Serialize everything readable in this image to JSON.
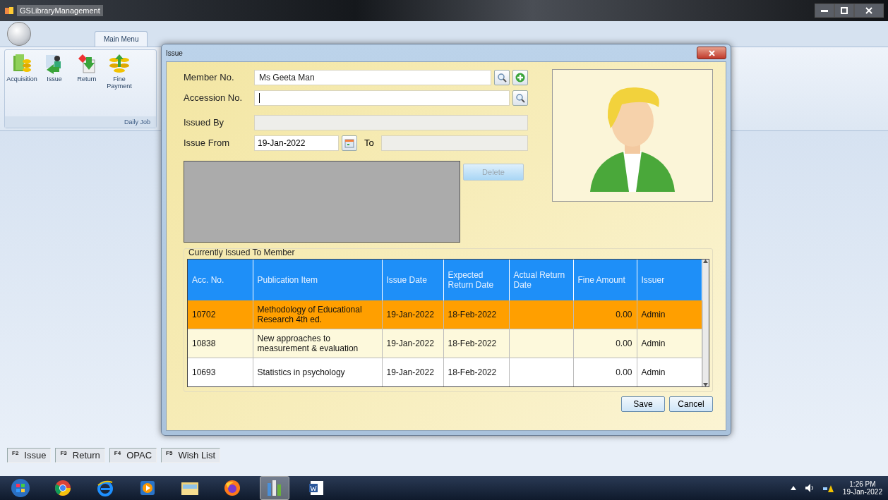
{
  "window": {
    "title": "GSLibraryManagement"
  },
  "ribbon": {
    "tabs": [
      {
        "label": "Main Menu",
        "selected": true
      }
    ],
    "groups": [
      {
        "label": "Daily Job",
        "buttons": [
          {
            "label": "Acquisition",
            "kind": "acquisition"
          },
          {
            "label": "Issue",
            "kind": "issue"
          },
          {
            "label": "Return",
            "kind": "return"
          },
          {
            "label": "Fine Payment",
            "kind": "payment"
          }
        ]
      }
    ]
  },
  "dialog": {
    "title": "Issue",
    "fields": [
      {
        "kind": "lookup_add",
        "label": "Member No.",
        "value": "Ms Geeta Man",
        "focused": false
      },
      {
        "kind": "lookup",
        "label": "Accession No.",
        "focused": true
      },
      {
        "kind": "readonly",
        "label": "Issued By"
      },
      {
        "kind": "date_range",
        "label": "Issue From",
        "value": "19-Jan-2022",
        "to_label": "To"
      }
    ],
    "delete_button": {
      "label": "Delete",
      "disabled": true
    },
    "issued_group": {
      "title": "Currently Issued To Member",
      "columns": [
        {
          "label": "Acc. No.",
          "kind": "text"
        },
        {
          "label": "Publication Item",
          "kind": "text"
        },
        {
          "label": "Issue Date",
          "kind": "text"
        },
        {
          "label": "Expected Return Date",
          "kind": "text"
        },
        {
          "label": "Actual Return Date",
          "kind": "text"
        },
        {
          "label": "Fine Amount",
          "kind": "number"
        },
        {
          "label": "Issuer",
          "kind": "text"
        }
      ],
      "rows": [
        {
          "selected": true,
          "cells": [
            "10702",
            "Methodology of Educational Research 4th ed.",
            "19-Jan-2022",
            "18-Feb-2022",
            "",
            "0.00",
            "Admin"
          ]
        },
        {
          "selected": false,
          "cells": [
            "10838",
            "New approaches to measurement & evaluation",
            "19-Jan-2022",
            "18-Feb-2022",
            "",
            "0.00",
            "Admin"
          ]
        },
        {
          "selected": false,
          "cells": [
            "10693",
            "Statistics in psychology",
            "19-Jan-2022",
            "18-Feb-2022",
            "",
            "0.00",
            "Admin"
          ]
        }
      ]
    },
    "buttons": [
      {
        "label": "Save"
      },
      {
        "label": "Cancel"
      }
    ]
  },
  "function_keys": [
    {
      "key": "F2",
      "label": "Issue"
    },
    {
      "key": "F3",
      "label": "Return"
    },
    {
      "key": "F4",
      "label": "OPAC"
    },
    {
      "key": "F5",
      "label": "Wish List"
    }
  ],
  "taskbar": {
    "apps": [
      {
        "kind": "start",
        "active": false
      },
      {
        "kind": "chrome",
        "active": false
      },
      {
        "kind": "ie",
        "active": false
      },
      {
        "kind": "media",
        "active": false
      },
      {
        "kind": "folder",
        "active": false
      },
      {
        "kind": "firefox",
        "active": false
      },
      {
        "kind": "app",
        "active": true
      },
      {
        "kind": "word",
        "active": false
      }
    ],
    "time": "1:26 PM",
    "date": "19-Jan-2022"
  }
}
